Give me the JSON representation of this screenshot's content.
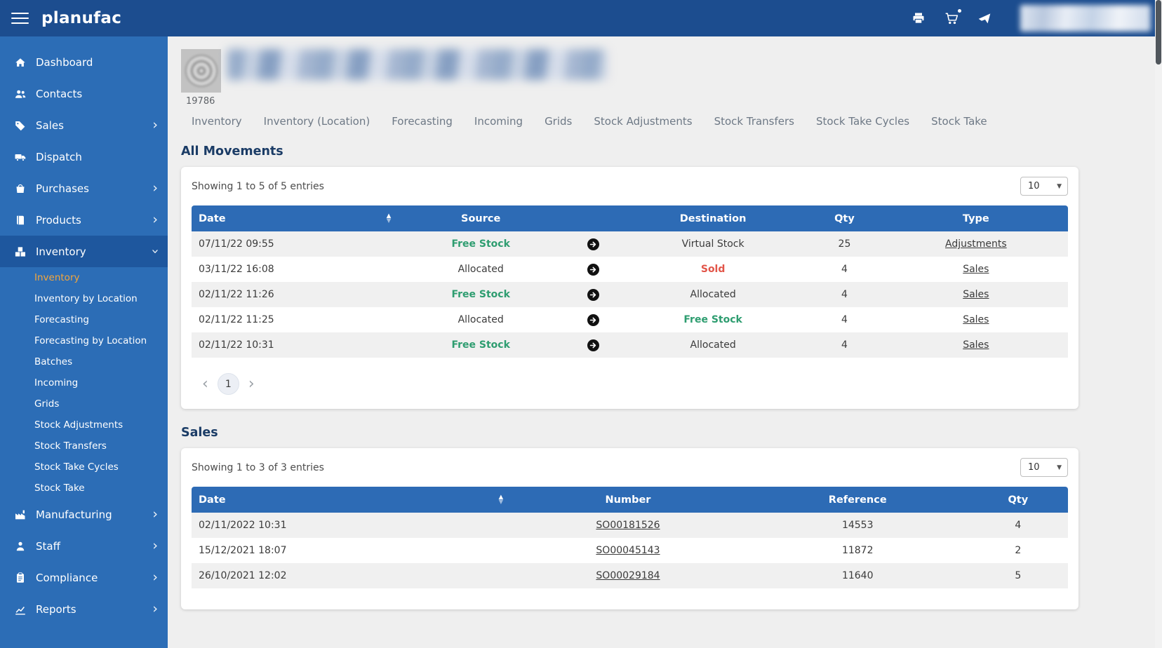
{
  "app": {
    "brand": "planufac"
  },
  "colors": {
    "topbar": "#1c4d8f",
    "sidebar": "#2c6db6",
    "sidebar_active_parent": "#1e579e",
    "active_submenu_text": "#f4a63b",
    "table_header": "#2d6bb5",
    "positive_green": "#2e9d70",
    "negative_red": "#e25549",
    "section_heading": "#1b3c66"
  },
  "icons": {
    "menu": "hamburger (3 bars)",
    "printer": "printer glyph",
    "cart": "shopping cart glyph",
    "paper_plane": "paper plane glyph",
    "chevron_right": "›",
    "chevron_down": "› rotated",
    "sort": "▲▼",
    "arrow_circle": "black circle with white right arrow",
    "caret_down": "▼",
    "pager_prev": "‹",
    "pager_next": "›"
  },
  "product": {
    "code": "19786"
  },
  "sidebar": {
    "items": [
      {
        "label": "Dashboard"
      },
      {
        "label": "Contacts"
      },
      {
        "label": "Sales"
      },
      {
        "label": "Dispatch"
      },
      {
        "label": "Purchases"
      },
      {
        "label": "Products"
      },
      {
        "label": "Inventory"
      },
      {
        "label": "Manufacturing"
      },
      {
        "label": "Staff"
      },
      {
        "label": "Compliance"
      },
      {
        "label": "Reports"
      }
    ],
    "inventory_submenu": [
      "Inventory",
      "Inventory by Location",
      "Forecasting",
      "Forecasting by Location",
      "Batches",
      "Incoming",
      "Grids",
      "Stock Adjustments",
      "Stock Transfers",
      "Stock Take Cycles",
      "Stock Take"
    ],
    "active_item": "Inventory",
    "active_submenu_item": "Inventory"
  },
  "tabs": [
    "Inventory",
    "Inventory (Location)",
    "Forecasting",
    "Incoming",
    "Grids",
    "Stock Adjustments",
    "Stock Transfers",
    "Stock Take Cycles",
    "Stock Take"
  ],
  "movements": {
    "title": "All Movements",
    "showing": "Showing 1 to 5 of 5 entries",
    "page_size": "10",
    "page": "1",
    "columns": {
      "date": "Date",
      "source": "Source",
      "destination": "Destination",
      "qty": "Qty",
      "type": "Type"
    },
    "rows": [
      {
        "date": "07/11/22 09:55",
        "source": "Free Stock",
        "destination": "Virtual Stock",
        "qty": "25",
        "type": "Adjustments"
      },
      {
        "date": "03/11/22 16:08",
        "source": "Allocated",
        "destination": "Sold",
        "qty": "4",
        "type": "Sales"
      },
      {
        "date": "02/11/22 11:26",
        "source": "Free Stock",
        "destination": "Allocated",
        "qty": "4",
        "type": "Sales"
      },
      {
        "date": "02/11/22 11:25",
        "source": "Allocated",
        "destination": "Free Stock",
        "qty": "4",
        "type": "Sales"
      },
      {
        "date": "02/11/22 10:31",
        "source": "Free Stock",
        "destination": "Allocated",
        "qty": "4",
        "type": "Sales"
      }
    ]
  },
  "sales": {
    "title": "Sales",
    "showing": "Showing 1 to 3 of 3 entries",
    "page_size": "10",
    "columns": {
      "date": "Date",
      "number": "Number",
      "reference": "Reference",
      "qty": "Qty"
    },
    "rows": [
      {
        "date": "02/11/2022 10:31",
        "number": "SO00181526",
        "reference": "14553",
        "qty": "4"
      },
      {
        "date": "15/12/2021 18:07",
        "number": "SO00045143",
        "reference": "11872",
        "qty": "2"
      },
      {
        "date": "26/10/2021 12:02",
        "number": "SO00029184",
        "reference": "11640",
        "qty": "5"
      }
    ]
  }
}
